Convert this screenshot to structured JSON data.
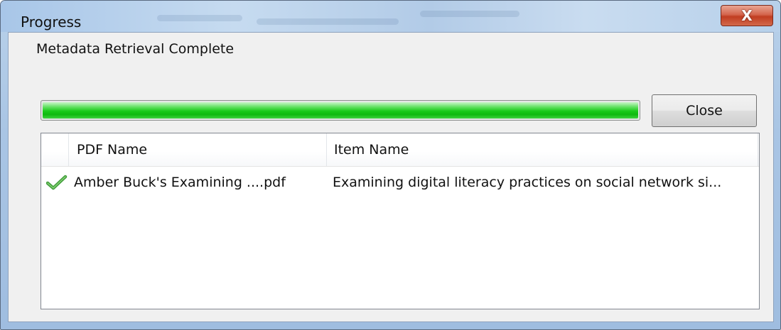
{
  "window": {
    "title": "Progress",
    "close_glyph": "X"
  },
  "status": {
    "label": "Metadata Retrieval Complete",
    "progress_fraction": 1.0,
    "progress_color": "#19c919"
  },
  "actions": {
    "close_label": "Close"
  },
  "table": {
    "columns": [
      "PDF Name",
      "Item Name"
    ],
    "rows": [
      {
        "status_icon": "checkmark-icon",
        "pdf_name": "Amber Buck's Examining ....pdf",
        "item_name": "Examining digital literacy practices on social network si..."
      }
    ]
  }
}
